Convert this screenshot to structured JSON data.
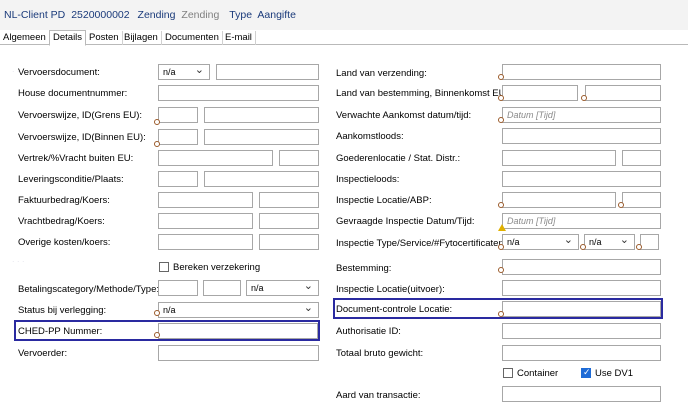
{
  "header": {
    "client": "NL-Client PD",
    "number": "2520000002",
    "type_word": "Zending",
    "type_word_dim": "Zending",
    "type_label": "Type",
    "type_value": "Aangifte"
  },
  "tabs": [
    "Algemeen",
    "Details",
    "Posten",
    "Bijlagen",
    "Documenten",
    "E-mail"
  ],
  "left": {
    "vervoersdocument": "Vervoersdocument:",
    "vervoersdocument_value": "n/a",
    "house": "House documentnummer:",
    "vervoerswijze_grens": "Vervoerswijze, ID(Grens EU):",
    "vervoerswijze_binnen": "Vervoerswijze, ID(Binnen EU):",
    "vertrek": "Vertrek/%Vracht buiten EU:",
    "levering": "Leveringsconditie/Plaats:",
    "faktuur": "Faktuurbedrag/Koers:",
    "vracht": "Vrachtbedrag/Koers:",
    "overige": "Overige kosten/koers:",
    "bereken": "Bereken verzekering",
    "betaling": "Betalingscategory/Methode/Type:",
    "betaling_value": "n/a",
    "status": "Status bij verlegging:",
    "status_value": "n/a",
    "ched": "CHED-PP Nummer:",
    "vervoerder": "Vervoerder:"
  },
  "right": {
    "land_verzending": "Land van verzending:",
    "land_bestemming": "Land van bestemming, Binnenkomst EU:",
    "verwachte": "Verwachte Aankomst datum/tijd:",
    "verwachte_placeholder": "Datum [Tijd]",
    "aankomstloods": "Aankomstloods:",
    "goederenlocatie": "Goederenlocatie / Stat. Distr.:",
    "inspectieloods": "Inspectieloods:",
    "inspectie_locatie": "Inspectie Locatie/ABP:",
    "gevraagde": "Gevraagde Inspectie Datum/Tijd:",
    "gevraagde_placeholder": "Datum [Tijd]",
    "inspectie_type": "Inspectie Type/Service/#Fytocertificaten:",
    "inspectie_type_value": "n/a",
    "inspectie_service_value": "n/a",
    "bestemming": "Bestemming:",
    "inspectie_uitvoer": "Inspectie Locatie(uitvoer):",
    "document_controle": "Document-controle Locatie:",
    "authorisatie": "Authorisatie ID:",
    "totaal": "Totaal bruto gewicht:",
    "container": "Container",
    "use_dv1": "Use DV1",
    "aard": "Aard van transactie:"
  },
  "colors": {
    "title_text": "#1a3a7a",
    "highlight": "#2a2aa0",
    "required_dot": "#9a5a2a",
    "checkbox_checked": "#1e6bd6"
  }
}
